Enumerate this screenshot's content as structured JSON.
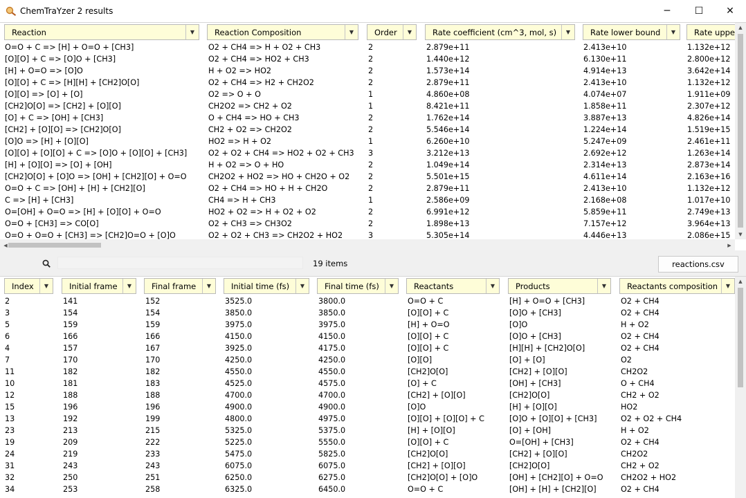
{
  "window": {
    "title": "ChemTraYzer 2 results",
    "minimize": "─",
    "maximize": "☐",
    "close": "✕"
  },
  "reactions_table": {
    "columns": [
      "Reaction",
      "Reaction Composition",
      "Order",
      "Rate coefficient (cm^3, mol, s)",
      "Rate lower bound",
      "Rate uppe"
    ],
    "rows": [
      [
        "O=O + C => [H] + O=O + [CH3]",
        "O2 + CH4 => H + O2 + CH3",
        "2",
        "2.879e+11",
        "2.413e+10",
        "1.132e+12"
      ],
      [
        "[O][O] + C => [O]O + [CH3]",
        "O2 + CH4 => HO2 + CH3",
        "2",
        "1.440e+12",
        "6.130e+11",
        "2.800e+12"
      ],
      [
        "[H] + O=O => [O]O",
        "H + O2 => HO2",
        "2",
        "1.573e+14",
        "4.914e+13",
        "3.642e+14"
      ],
      [
        "[O][O] + C => [H][H] + [CH2]O[O]",
        "O2 + CH4 => H2 + CH2O2",
        "2",
        "2.879e+11",
        "2.413e+10",
        "1.132e+12"
      ],
      [
        "[O][O] => [O] + [O]",
        "O2 => O + O",
        "1",
        "4.860e+08",
        "4.074e+07",
        "1.911e+09"
      ],
      [
        "[CH2]O[O] => [CH2] + [O][O]",
        "CH2O2 => CH2 + O2",
        "1",
        "8.421e+11",
        "1.858e+11",
        "2.307e+12"
      ],
      [
        "[O] + C => [OH] + [CH3]",
        "O + CH4 => HO + CH3",
        "2",
        "1.762e+14",
        "3.887e+13",
        "4.826e+14"
      ],
      [
        "[CH2] + [O][O] => [CH2]O[O]",
        "CH2 + O2 => CH2O2",
        "2",
        "5.546e+14",
        "1.224e+14",
        "1.519e+15"
      ],
      [
        "[O]O => [H] + [O][O]",
        "HO2 => H + O2",
        "1",
        "6.260e+10",
        "5.247e+09",
        "2.461e+11"
      ],
      [
        "[O][O] + [O][O] + C => [O]O + [O][O] + [CH3]",
        "O2 + O2 + CH4 => HO2 + O2 + CH3",
        "3",
        "3.212e+13",
        "2.692e+12",
        "1.263e+14"
      ],
      [
        "[H] + [O][O] => [O] + [OH]",
        "H + O2 => O + HO",
        "2",
        "1.049e+14",
        "2.314e+13",
        "2.873e+14"
      ],
      [
        "[CH2]O[O] + [O]O => [OH] + [CH2][O] + O=O",
        "CH2O2 + HO2 => HO + CH2O + O2",
        "2",
        "5.501e+15",
        "4.611e+14",
        "2.163e+16"
      ],
      [
        "O=O + C => [OH] + [H] + [CH2][O]",
        "O2 + CH4 => HO + H + CH2O",
        "2",
        "2.879e+11",
        "2.413e+10",
        "1.132e+12"
      ],
      [
        "C => [H] + [CH3]",
        "CH4 => H + CH3",
        "1",
        "2.586e+09",
        "2.168e+08",
        "1.017e+10"
      ],
      [
        "O=[OH] + O=O => [H] + [O][O] + O=O",
        "HO2 + O2 => H + O2 + O2",
        "2",
        "6.991e+12",
        "5.859e+11",
        "2.749e+13"
      ],
      [
        "O=O + [CH3] => CO[O]",
        "O2 + CH3 => CH3O2",
        "2",
        "1.898e+13",
        "7.157e+12",
        "3.964e+13"
      ],
      [
        "O=O + O=O + [CH3] => [CH2]O=O + [O]O",
        "O2 + O2 + CH3 => CH2O2 + HO2",
        "3",
        "5.305e+14",
        "4.446e+13",
        "2.086e+15"
      ]
    ]
  },
  "toolbar": {
    "search_placeholder": "",
    "item_count": "19 items",
    "export_label": "reactions.csv"
  },
  "events_table": {
    "columns": [
      "Index",
      "Initial frame",
      "Final frame",
      "Initial time (fs)",
      "Final time (fs)",
      "Reactants",
      "Products",
      "Reactants composition"
    ],
    "rows": [
      [
        "2",
        "141",
        "152",
        "3525.0",
        "3800.0",
        "O=O + C",
        "[H] + O=O + [CH3]",
        "O2 + CH4"
      ],
      [
        "3",
        "154",
        "154",
        "3850.0",
        "3850.0",
        "[O][O] + C",
        "[O]O + [CH3]",
        "O2 + CH4"
      ],
      [
        "5",
        "159",
        "159",
        "3975.0",
        "3975.0",
        "[H] + O=O",
        "[O]O",
        "H + O2"
      ],
      [
        "6",
        "166",
        "166",
        "4150.0",
        "4150.0",
        "[O][O] + C",
        "[O]O + [CH3]",
        "O2 + CH4"
      ],
      [
        "4",
        "157",
        "167",
        "3925.0",
        "4175.0",
        "[O][O] + C",
        "[H][H] + [CH2]O[O]",
        "O2 + CH4"
      ],
      [
        "7",
        "170",
        "170",
        "4250.0",
        "4250.0",
        "[O][O]",
        "[O] + [O]",
        "O2"
      ],
      [
        "11",
        "182",
        "182",
        "4550.0",
        "4550.0",
        "[CH2]O[O]",
        "[CH2] + [O][O]",
        "CH2O2"
      ],
      [
        "10",
        "181",
        "183",
        "4525.0",
        "4575.0",
        "[O] + C",
        "[OH] + [CH3]",
        "O + CH4"
      ],
      [
        "12",
        "188",
        "188",
        "4700.0",
        "4700.0",
        "[CH2] + [O][O]",
        "[CH2]O[O]",
        "CH2 + O2"
      ],
      [
        "15",
        "196",
        "196",
        "4900.0",
        "4900.0",
        "[O]O",
        "[H] + [O][O]",
        "HO2"
      ],
      [
        "13",
        "192",
        "199",
        "4800.0",
        "4975.0",
        "[O][O] + [O][O] + C",
        "[O]O + [O][O] + [CH3]",
        "O2 + O2 + CH4"
      ],
      [
        "23",
        "213",
        "215",
        "5325.0",
        "5375.0",
        "[H] + [O][O]",
        "[O] + [OH]",
        "H + O2"
      ],
      [
        "19",
        "209",
        "222",
        "5225.0",
        "5550.0",
        "[O][O] + C",
        "O=[OH] + [CH3]",
        "O2 + CH4"
      ],
      [
        "24",
        "219",
        "233",
        "5475.0",
        "5825.0",
        "[CH2]O[O]",
        "[CH2] + [O][O]",
        "CH2O2"
      ],
      [
        "31",
        "243",
        "243",
        "6075.0",
        "6075.0",
        "[CH2] + [O][O]",
        "[CH2]O[O]",
        "CH2 + O2"
      ],
      [
        "32",
        "250",
        "251",
        "6250.0",
        "6275.0",
        "[CH2]O[O] + [O]O",
        "[OH] + [CH2][O] + O=O",
        "CH2O2 + HO2"
      ],
      [
        "34",
        "253",
        "258",
        "6325.0",
        "6450.0",
        "O=O + C",
        "[OH] + [H] + [CH2][O]",
        "O2 + CH4"
      ]
    ]
  }
}
